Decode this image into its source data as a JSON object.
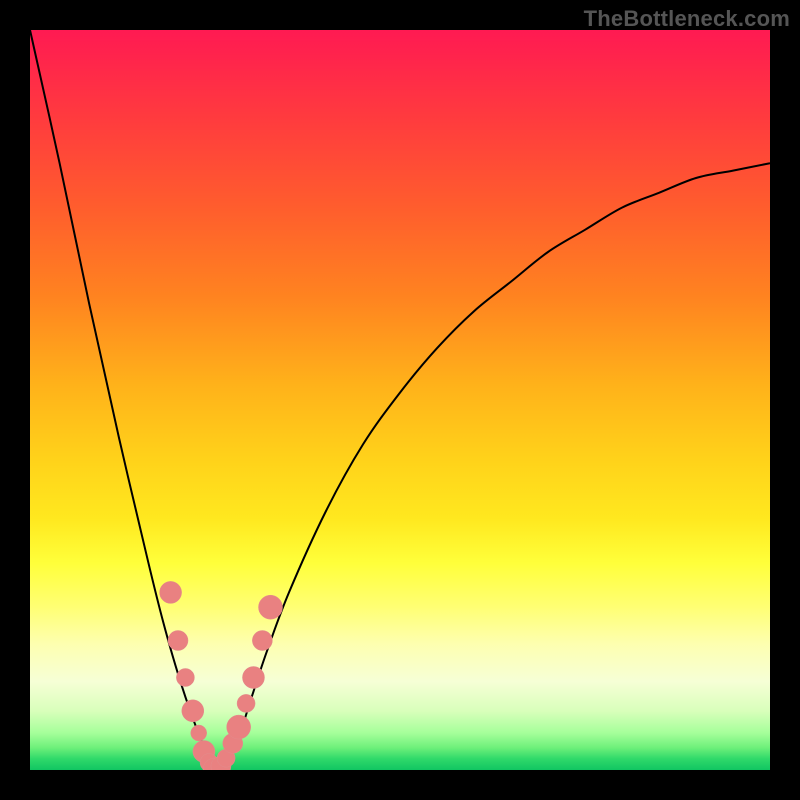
{
  "watermark": "TheBottleneck.com",
  "colors": {
    "frame": "#000000",
    "curve": "#000000",
    "dots": "#e98181",
    "gradient_top": "#ff1a52",
    "gradient_bottom": "#11c562"
  },
  "chart_data": {
    "type": "line",
    "title": "",
    "xlabel": "",
    "ylabel": "",
    "xlim": [
      0,
      100
    ],
    "ylim": [
      0,
      100
    ],
    "note": "Axes are unlabeled; values estimated from geometry. y represents bottleneck percentage (0 at bottom/green, 100 at top/red). Curve minimum (optimal match) occurs near x≈25.",
    "series": [
      {
        "name": "bottleneck-curve",
        "x": [
          0,
          4,
          8,
          12,
          16,
          18,
          20,
          22,
          24,
          25,
          26,
          28,
          30,
          32,
          35,
          40,
          45,
          50,
          55,
          60,
          65,
          70,
          75,
          80,
          85,
          90,
          95,
          100
        ],
        "values": [
          100,
          82,
          63,
          45,
          28,
          20,
          13,
          7,
          2,
          0,
          1,
          4,
          10,
          16,
          24,
          35,
          44,
          51,
          57,
          62,
          66,
          70,
          73,
          76,
          78,
          80,
          81,
          82
        ]
      }
    ],
    "highlight_points": {
      "name": "sample-dots",
      "x": [
        19.0,
        20.0,
        21.0,
        22.0,
        22.8,
        23.5,
        24.2,
        25.0,
        25.8,
        26.5,
        27.4,
        28.2,
        29.2,
        30.2,
        31.4,
        32.5
      ],
      "values": [
        24.0,
        17.5,
        12.5,
        8.0,
        5.0,
        2.5,
        1.0,
        0.0,
        0.5,
        1.6,
        3.6,
        5.8,
        9.0,
        12.5,
        17.5,
        22.0
      ],
      "r": [
        11,
        10,
        9,
        11,
        8,
        11,
        9,
        12,
        10,
        9,
        10,
        12,
        9,
        11,
        10,
        12
      ]
    }
  }
}
